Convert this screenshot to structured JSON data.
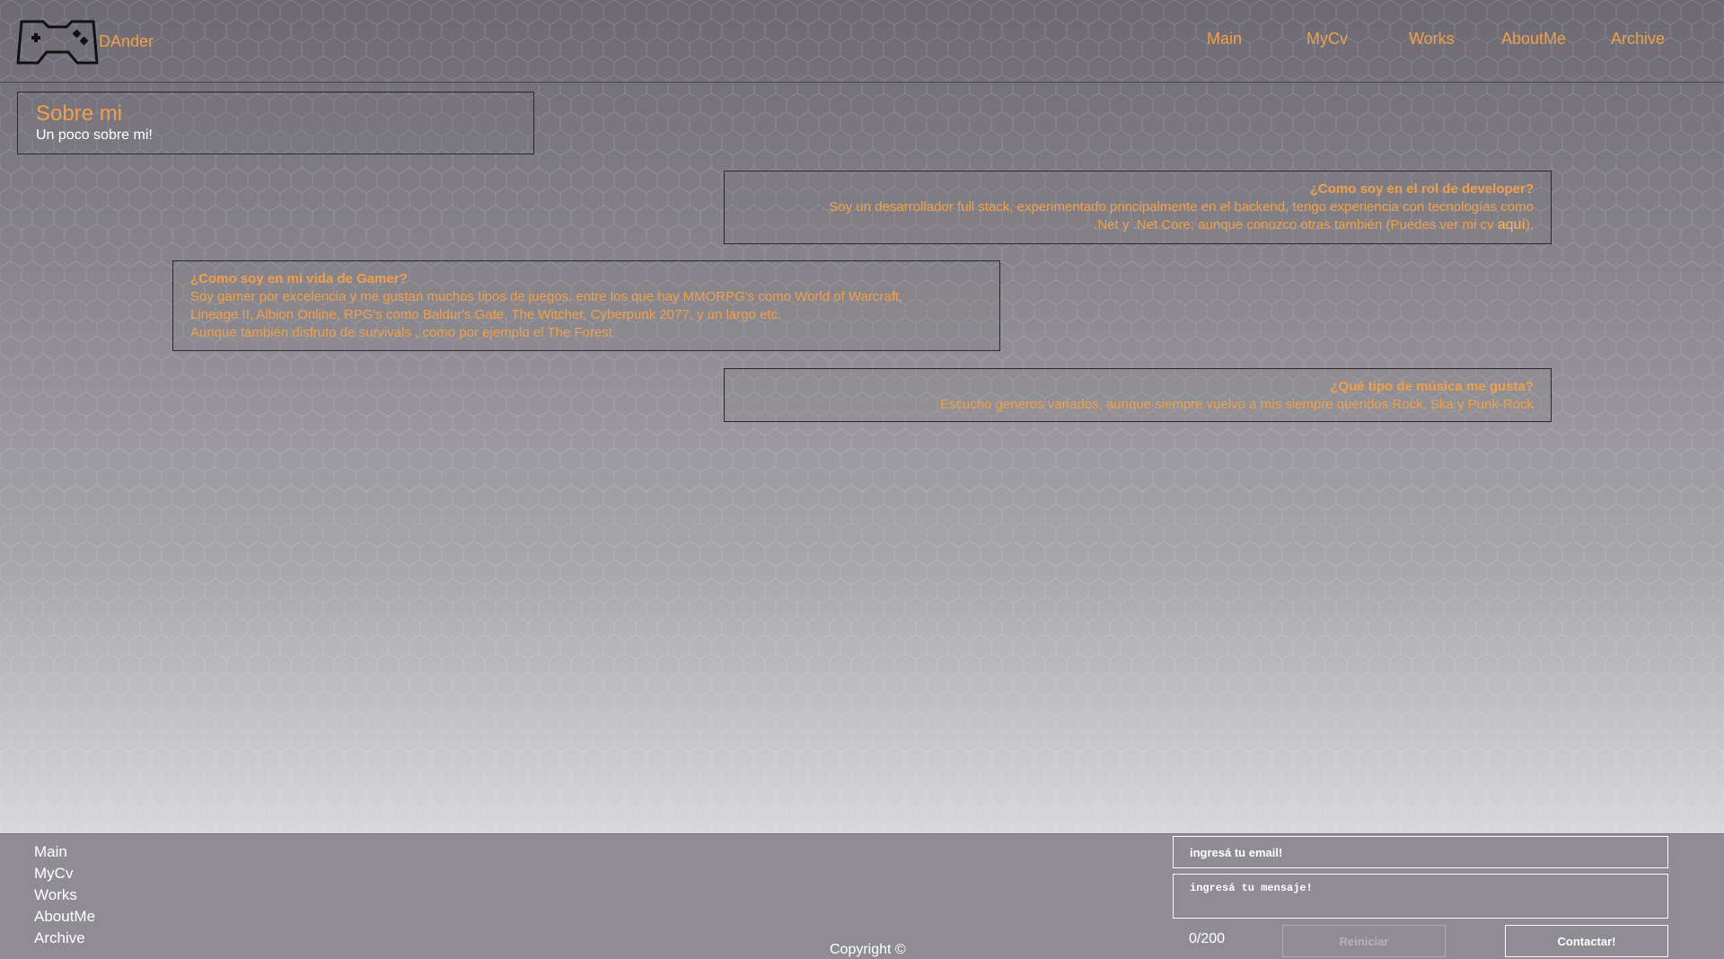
{
  "header": {
    "brand": "DAnder",
    "nav": [
      "Main",
      "MyCv",
      "Works",
      "AboutMe",
      "Archive"
    ]
  },
  "title_card": {
    "title": "Sobre mi",
    "subtitle": "Un poco sobre mi!"
  },
  "cards": {
    "developer": {
      "question": "¿Como soy en el rol de developer?",
      "line1": "Soy un desarrollador full stack, experimentado principalmente en el backend, tengo experiencia con tecnologías como",
      "line2_pre": ".Net y .Net Core; aunque conozco otras también (Puedes ver mi cv ",
      "link": "aquí",
      "line2_post": ")."
    },
    "gamer": {
      "question": "¿Como soy en mi vida de Gamer?",
      "line1": "Soy gamer por excelencia y me gustan muchos tipos de juegos, entre los que hay MMORPG's como World of Warcraft,",
      "line2": "Lineage II, Albion Online, RPG's como Baldur's Gate, The Witcher, Cyberpunk 2077, y un largo etc.",
      "line3": "Aunque también disfruto de survivals , como por ejemplo el The Forest"
    },
    "music": {
      "question": "¿Qué tipo de música me gusta?",
      "line1": "Escucho generos variados, aunque siempre vuelvo a mis siempre queridos Rock, Ska y Punk-Rock"
    }
  },
  "footer": {
    "links": [
      "Main",
      "MyCv",
      "Works",
      "AboutMe",
      "Archive"
    ],
    "copyright": "Copyright ©",
    "email_placeholder": "ingresá tu email!",
    "message_placeholder": "ingresá tu mensaje!",
    "counter": "0/200",
    "reset_label": "Reiniciar",
    "send_label": "Contactar!"
  },
  "colors": {
    "accent": "#f0a04c",
    "text_light": "#ffffff"
  },
  "icons": {
    "logo": "gamepad-icon"
  }
}
